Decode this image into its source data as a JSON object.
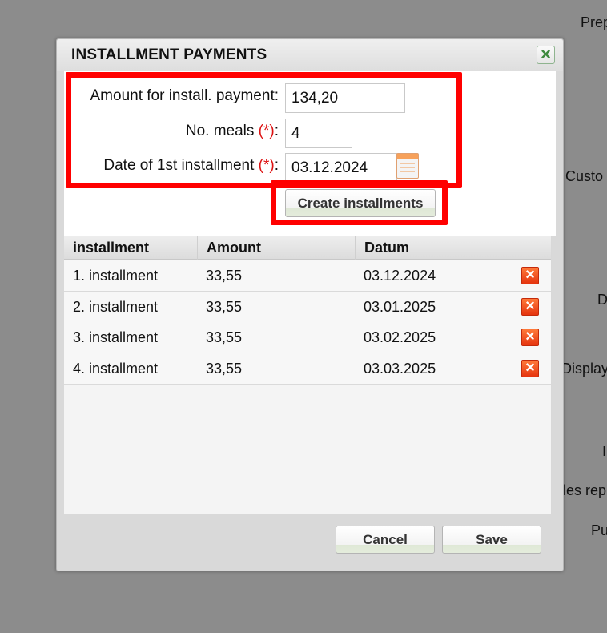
{
  "background": {
    "labels": [
      "Prep",
      "Custo",
      "D",
      "Display",
      "I",
      "ales rep",
      "Pu"
    ]
  },
  "dialog": {
    "title": "INSTALLMENT PAYMENTS",
    "close_icon": "close-icon",
    "form": {
      "amount_label": "Amount for install. payment:",
      "amount_value": "134,20",
      "meals_label": "No. meals",
      "meals_value": "4",
      "date_label": "Date of 1st installment",
      "date_value": "03.12.2024",
      "required_mark": "(*)",
      "colon": ":"
    },
    "create_button": "Create installments",
    "table": {
      "columns": [
        "installment",
        "Amount",
        "Datum"
      ],
      "rows": [
        {
          "installment": "1. installment",
          "amount": "33,55",
          "date": "03.12.2024"
        },
        {
          "installment": "2. installment",
          "amount": "33,55",
          "date": "03.01.2025"
        },
        {
          "installment": "3. installment",
          "amount": "33,55",
          "date": "03.02.2025"
        },
        {
          "installment": "4. installment",
          "amount": "33,55",
          "date": "03.03.2025"
        }
      ],
      "delete_icon": "delete-icon"
    },
    "cancel_button": "Cancel",
    "save_button": "Save"
  },
  "colors": {
    "highlight": "#ff0000",
    "required": "#dd1111",
    "overlay": "#8c8c8c"
  }
}
